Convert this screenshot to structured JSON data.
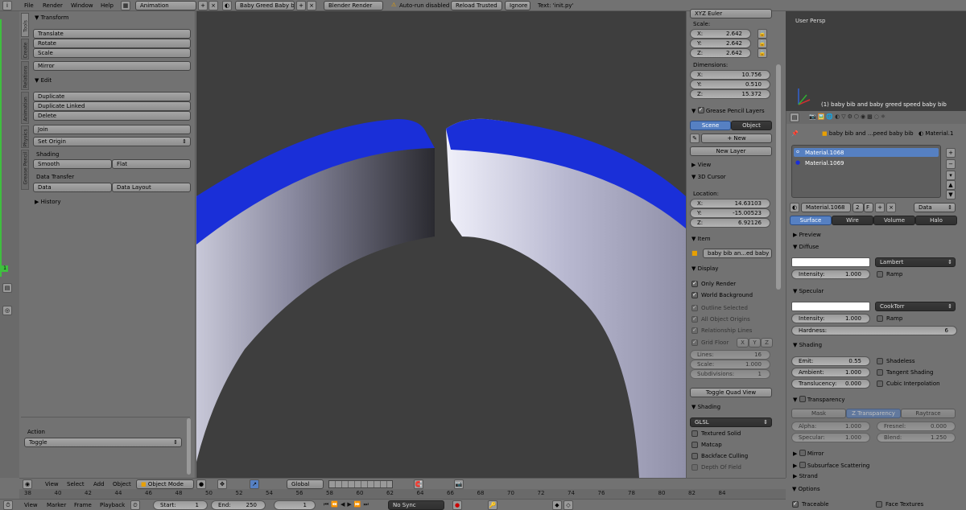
{
  "topbar": {
    "menus": [
      "File",
      "Render",
      "Window",
      "Help"
    ],
    "layout": "Animation",
    "scene": "Baby Greed Baby bib",
    "engine": "Blender Render",
    "warning": "Auto-run disabled",
    "reload": "Reload Trusted",
    "ignore": "Ignore",
    "text": "Text: 'init.py'"
  },
  "side_tabs": [
    "Tools",
    "Create",
    "Relations",
    "Animation",
    "Physics",
    "Grease Pencil"
  ],
  "tools": {
    "transform": "Transform",
    "translate": "Translate",
    "rotate": "Rotate",
    "scale": "Scale",
    "mirror": "Mirror",
    "edit": "Edit",
    "duplicate": "Duplicate",
    "duplicate_linked": "Duplicate Linked",
    "delete": "Delete",
    "join": "Join",
    "set_origin": "Set Origin",
    "shading": "Shading",
    "smooth": "Smooth",
    "flat": "Flat",
    "data_transfer": "Data Transfer",
    "data": "Data",
    "data_layout": "Data Layout",
    "history": "History",
    "action": "Action",
    "toggle": "Toggle"
  },
  "n_panel": {
    "rot_mode": "XYZ Euler",
    "scale_label": "Scale:",
    "scale": {
      "x": "2.642",
      "y": "2.642",
      "z": "2.642"
    },
    "dimensions_label": "Dimensions:",
    "dims": {
      "x": "10.756",
      "y": "0.510",
      "z": "15.372"
    },
    "grease": "Grease Pencil Layers",
    "scene": "Scene",
    "object": "Object",
    "new": "New",
    "new_layer": "New Layer",
    "view": "View",
    "cursor": "3D Cursor",
    "location": "Location:",
    "loc": {
      "x": "14.63103",
      "y": "-15.00523",
      "z": "6.92126"
    },
    "item": "Item",
    "item_name": "baby bib an...ed baby bib",
    "display": "Display",
    "only_render": "Only Render",
    "world_bg": "World Background",
    "outline": "Outline Selected",
    "all_origins": "All Object Origins",
    "rel_lines": "Relationship Lines",
    "grid_floor": "Grid Floor",
    "gx": "X",
    "gy": "Y",
    "gz": "Z",
    "lines_l": "Lines:",
    "lines_v": "16",
    "gscale_l": "Scale:",
    "gscale_v": "1.000",
    "subdiv_l": "Subdivisions:",
    "subdiv_v": "1",
    "quad": "Toggle Quad View",
    "shading": "Shading",
    "glsl": "GLSL",
    "textured": "Textured Solid",
    "matcap": "Matcap",
    "backface": "Backface Culling",
    "depth": "Depth Of Field"
  },
  "viewport_small": {
    "label": "User Persp",
    "object": "(1) baby bib and baby greed speed baby bib"
  },
  "props": {
    "crumb1": "baby bib and ...peed baby bib",
    "crumb2": "Material.1",
    "materials": [
      "Material.1068",
      "Material.1069"
    ],
    "mat_name": "Material.1068",
    "users": "2",
    "fake": "F",
    "data": "Data",
    "tabs": [
      "Surface",
      "Wire",
      "Volume",
      "Halo"
    ],
    "preview": "Preview",
    "diffuse": "Diffuse",
    "lambert": "Lambert",
    "intensity_l": "Intensity:",
    "intensity_v": "1.000",
    "ramp": "Ramp",
    "specular": "Specular",
    "cooktorr": "CookTorr",
    "sintensity_v": "1.000",
    "hardness_l": "Hardness:",
    "hardness_v": "6",
    "shading": "Shading",
    "emit_l": "Emit:",
    "emit_v": "0.55",
    "ambient_l": "Ambient:",
    "ambient_v": "1.000",
    "transl_l": "Translucency:",
    "transl_v": "0.000",
    "shadeless": "Shadeless",
    "tangent": "Tangent Shading",
    "cubic": "Cubic Interpolation",
    "transparency": "Transparency",
    "mask": "Mask",
    "ztrans": "Z Transparency",
    "raytrace": "Raytrace",
    "alpha_l": "Alpha:",
    "alpha_v": "1.000",
    "fresnel_l": "Fresnel:",
    "fresnel_v": "0.000",
    "spec_l": "Specular:",
    "spec_v": "1.000",
    "blend_l": "Blend:",
    "blend_v": "1.250",
    "mirror": "Mirror",
    "sss": "Subsurface Scattering",
    "strand": "Strand",
    "options": "Options",
    "traceable": "Traceable",
    "face_tex": "Face Textures"
  },
  "view_header": {
    "view": "View",
    "select": "Select",
    "add": "Add",
    "object": "Object",
    "mode": "Object Mode",
    "orient": "Global"
  },
  "ruler": [
    "38",
    "40",
    "42",
    "44",
    "46",
    "48",
    "50",
    "52",
    "54",
    "56",
    "58",
    "60",
    "62",
    "64",
    "66",
    "68",
    "70",
    "72",
    "74",
    "76",
    "78",
    "80",
    "82",
    "84"
  ],
  "timeline": {
    "view": "View",
    "marker": "Marker",
    "frame": "Frame",
    "playback": "Playback",
    "start_l": "Start:",
    "start_v": "1",
    "end_l": "End:",
    "end_v": "250",
    "cur": "1",
    "sync": "No Sync"
  },
  "colors": {
    "blue": "#1a2fd8",
    "viewport": "#3e3e3e",
    "panel": "#727272"
  }
}
